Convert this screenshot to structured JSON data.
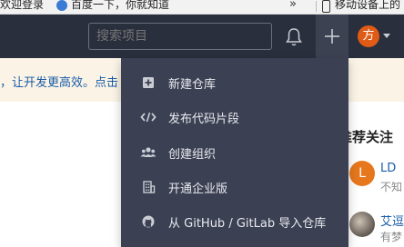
{
  "bookmarks": {
    "item1_label": "欢迎登录",
    "item2_label": "百度一下，你就知道",
    "more_chevron": "»",
    "item3_label": "移动设备上的"
  },
  "header": {
    "search_placeholder": "搜索项目",
    "avatar_letter": "方"
  },
  "banner": {
    "text": "，让开发更高效。点击"
  },
  "menu": {
    "items": [
      {
        "label": "新建仓库",
        "icon": "plus-square-icon"
      },
      {
        "label": "发布代码片段",
        "icon": "code-icon"
      },
      {
        "label": "创建组织",
        "icon": "users-icon"
      },
      {
        "label": "开通企业版",
        "icon": "building-icon"
      },
      {
        "label": "从 GitHub / GitLab 导入仓库",
        "icon": "github-icon"
      }
    ]
  },
  "sidebar": {
    "recommend_title": "推荐关注",
    "users": [
      {
        "avatar_letter": "L",
        "name": "LD",
        "desc": "不知"
      },
      {
        "name": "艾逗",
        "desc": "有梦"
      }
    ]
  },
  "colors": {
    "header_bg": "#2a2f3d",
    "menu_bg": "#3b4053",
    "avatar_orange": "#e05b16",
    "link_blue": "#1a5ca8"
  }
}
